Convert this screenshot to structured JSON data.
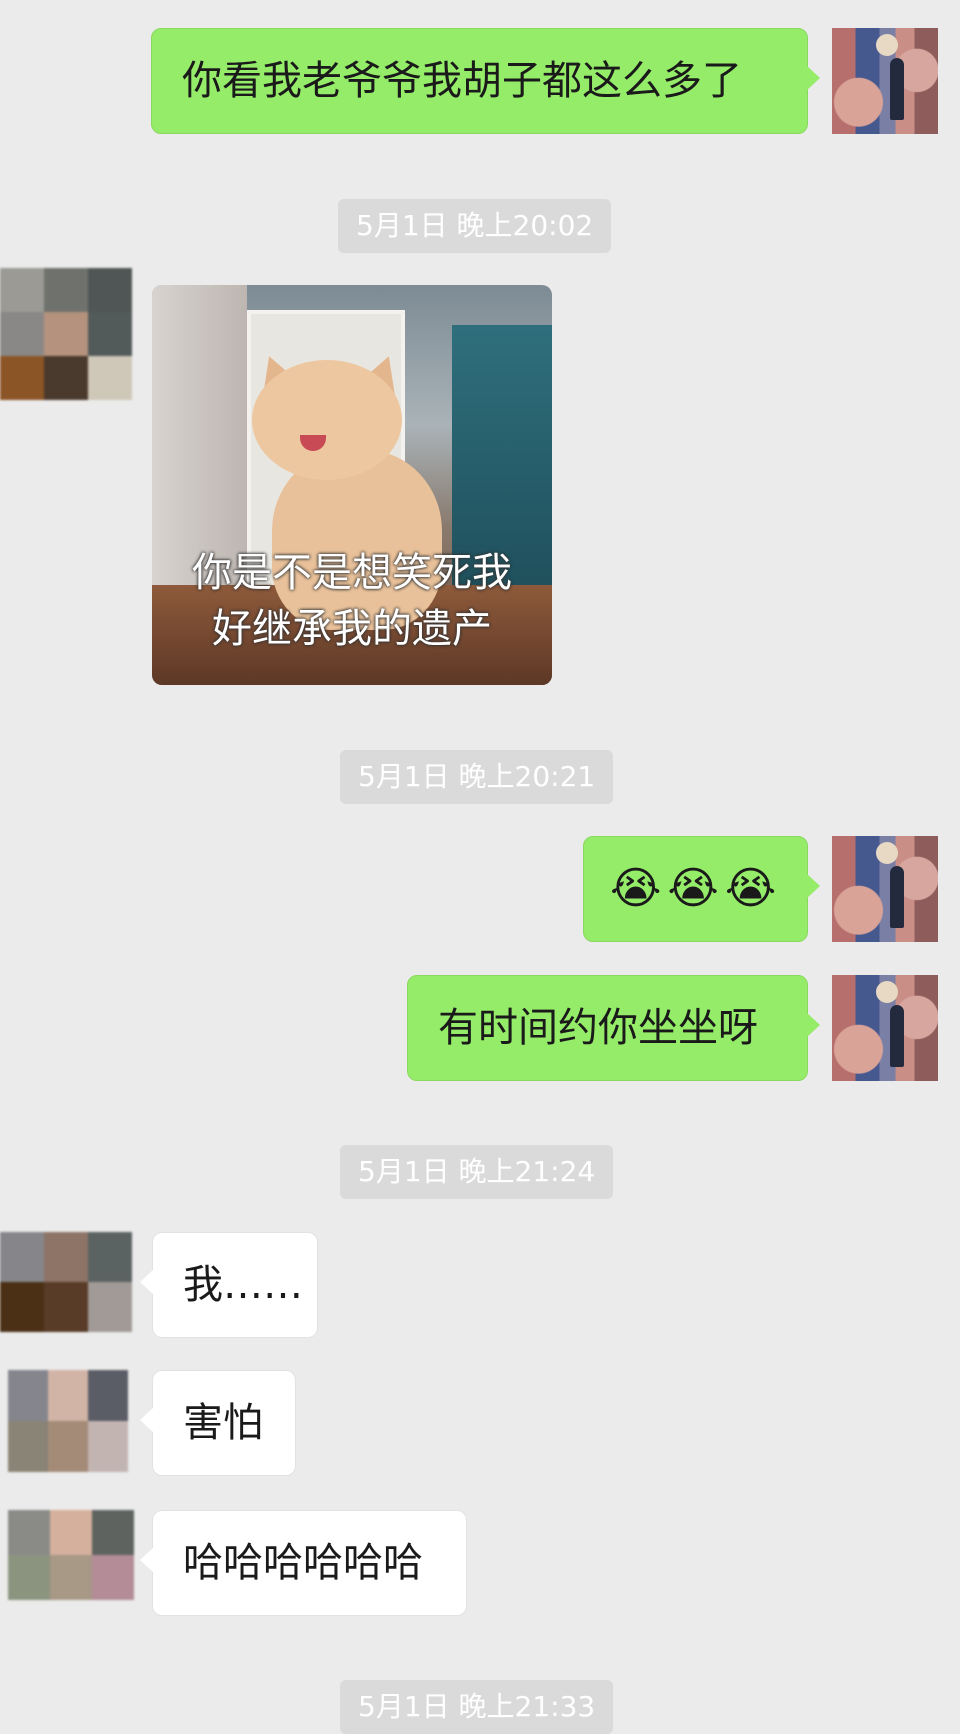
{
  "messages": {
    "m1": "你看我老爷爷我胡子都这么多了",
    "m2_caption_line1": "你是不是想笑死我",
    "m2_caption_line2": "好继承我的遗产",
    "m3_emojis": [
      "😭",
      "😭",
      "😭"
    ],
    "m4": "有时间约你坐坐呀",
    "m5": "我……",
    "m6": "害怕",
    "m7": "哈哈哈哈哈哈"
  },
  "timestamps": {
    "t1": "5月1日 晚上20:02",
    "t2": "5月1日 晚上20:21",
    "t3": "5月1日 晚上21:24",
    "t4": "5月1日 晚上21:33"
  },
  "colors": {
    "background": "#ebebeb",
    "outgoing_bubble": "#95ec69",
    "incoming_bubble": "#ffffff",
    "timestamp_bg": "#dadada"
  }
}
